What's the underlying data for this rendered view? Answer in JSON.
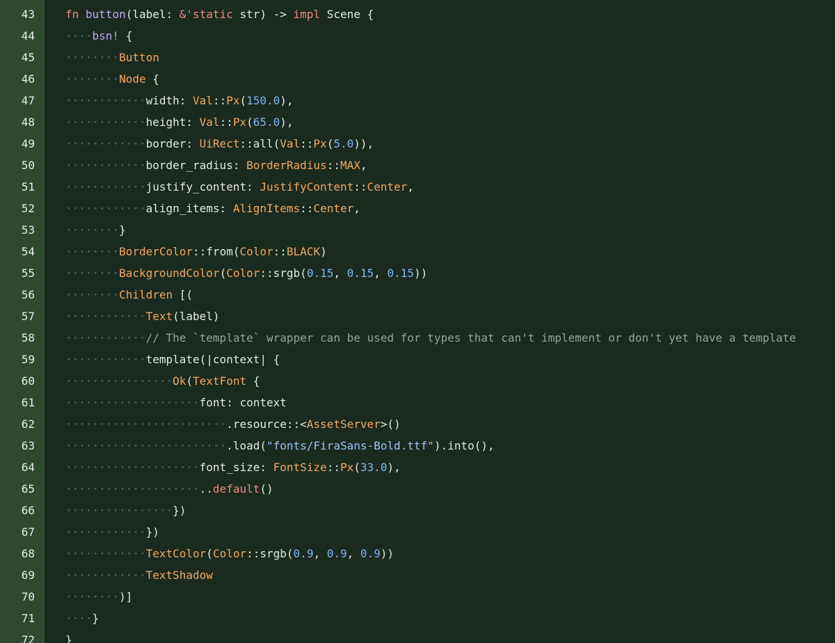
{
  "editor": {
    "colors": {
      "background": "#1a2a1e",
      "gutter": "#2d4a2f",
      "line_number": "#e8efe6",
      "indent_guide": "#5b6f5d",
      "keyword": "#ee8a86",
      "function": "#c5a6f4",
      "type": "#f3a863",
      "number": "#7db6f2",
      "string": "#9cc4f4",
      "comment": "#95a497",
      "plain": "#e4e9e1"
    },
    "lines": [
      {
        "n": "43",
        "tokens": [
          [
            "pl",
            ""
          ],
          [
            "kw",
            "fn"
          ],
          [
            "pl",
            " "
          ],
          [
            "fn",
            "button"
          ],
          [
            "pl",
            "(label: "
          ],
          [
            "kw",
            "&'static"
          ],
          [
            "pl",
            " str) "
          ],
          [
            "op",
            "->"
          ],
          [
            "pl",
            " "
          ],
          [
            "kw",
            "impl"
          ],
          [
            "pl",
            " Scene {"
          ]
        ]
      },
      {
        "n": "44",
        "tokens": [
          [
            "ind",
            "····"
          ],
          [
            "fn",
            "bsn!"
          ],
          [
            "pl",
            " {"
          ]
        ]
      },
      {
        "n": "45",
        "tokens": [
          [
            "ind",
            "········"
          ],
          [
            "ty",
            "Button"
          ]
        ]
      },
      {
        "n": "46",
        "tokens": [
          [
            "ind",
            "········"
          ],
          [
            "ty",
            "Node"
          ],
          [
            "pl",
            " {"
          ]
        ]
      },
      {
        "n": "47",
        "tokens": [
          [
            "ind",
            "············"
          ],
          [
            "pl",
            "width: "
          ],
          [
            "ty",
            "Val"
          ],
          [
            "pl",
            "::"
          ],
          [
            "ty",
            "Px"
          ],
          [
            "pl",
            "("
          ],
          [
            "num",
            "150.0"
          ],
          [
            "pl",
            "),"
          ]
        ]
      },
      {
        "n": "48",
        "tokens": [
          [
            "ind",
            "············"
          ],
          [
            "pl",
            "height: "
          ],
          [
            "ty",
            "Val"
          ],
          [
            "pl",
            "::"
          ],
          [
            "ty",
            "Px"
          ],
          [
            "pl",
            "("
          ],
          [
            "num",
            "65.0"
          ],
          [
            "pl",
            "),"
          ]
        ]
      },
      {
        "n": "49",
        "tokens": [
          [
            "ind",
            "············"
          ],
          [
            "pl",
            "border: "
          ],
          [
            "ty",
            "UiRect"
          ],
          [
            "pl",
            "::all("
          ],
          [
            "ty",
            "Val"
          ],
          [
            "pl",
            "::"
          ],
          [
            "ty",
            "Px"
          ],
          [
            "pl",
            "("
          ],
          [
            "num",
            "5.0"
          ],
          [
            "pl",
            ")),"
          ]
        ]
      },
      {
        "n": "50",
        "tokens": [
          [
            "ind",
            "············"
          ],
          [
            "pl",
            "border_radius: "
          ],
          [
            "ty",
            "BorderRadius"
          ],
          [
            "pl",
            "::"
          ],
          [
            "ty",
            "MAX"
          ],
          [
            "pl",
            ","
          ]
        ]
      },
      {
        "n": "51",
        "tokens": [
          [
            "ind",
            "············"
          ],
          [
            "pl",
            "justify_content: "
          ],
          [
            "ty",
            "JustifyContent"
          ],
          [
            "pl",
            "::"
          ],
          [
            "ty",
            "Center"
          ],
          [
            "pl",
            ","
          ]
        ]
      },
      {
        "n": "52",
        "tokens": [
          [
            "ind",
            "············"
          ],
          [
            "pl",
            "align_items: "
          ],
          [
            "ty",
            "AlignItems"
          ],
          [
            "pl",
            "::"
          ],
          [
            "ty",
            "Center"
          ],
          [
            "pl",
            ","
          ]
        ]
      },
      {
        "n": "53",
        "tokens": [
          [
            "ind",
            "········"
          ],
          [
            "pl",
            "}"
          ]
        ]
      },
      {
        "n": "54",
        "tokens": [
          [
            "ind",
            "········"
          ],
          [
            "ty",
            "BorderColor"
          ],
          [
            "pl",
            "::from("
          ],
          [
            "ty",
            "Color"
          ],
          [
            "pl",
            "::"
          ],
          [
            "ty",
            "BLACK"
          ],
          [
            "pl",
            ")"
          ]
        ]
      },
      {
        "n": "55",
        "tokens": [
          [
            "ind",
            "········"
          ],
          [
            "ty",
            "BackgroundColor"
          ],
          [
            "pl",
            "("
          ],
          [
            "ty",
            "Color"
          ],
          [
            "pl",
            "::srgb("
          ],
          [
            "num",
            "0.15"
          ],
          [
            "pl",
            ", "
          ],
          [
            "num",
            "0.15"
          ],
          [
            "pl",
            ", "
          ],
          [
            "num",
            "0.15"
          ],
          [
            "pl",
            "))"
          ]
        ]
      },
      {
        "n": "56",
        "tokens": [
          [
            "ind",
            "········"
          ],
          [
            "ty",
            "Children"
          ],
          [
            "pl",
            " [("
          ]
        ]
      },
      {
        "n": "57",
        "tokens": [
          [
            "ind",
            "············"
          ],
          [
            "ty",
            "Text"
          ],
          [
            "pl",
            "(label)"
          ]
        ]
      },
      {
        "n": "58",
        "tokens": [
          [
            "ind",
            "············"
          ],
          [
            "cm",
            "// The `template` wrapper can be used for types that can't implement or don't yet have a template"
          ]
        ]
      },
      {
        "n": "59",
        "tokens": [
          [
            "ind",
            "············"
          ],
          [
            "pl",
            "template(|context| {"
          ]
        ]
      },
      {
        "n": "60",
        "tokens": [
          [
            "ind",
            "················"
          ],
          [
            "ty",
            "Ok"
          ],
          [
            "pl",
            "("
          ],
          [
            "ty",
            "TextFont"
          ],
          [
            "pl",
            " {"
          ]
        ]
      },
      {
        "n": "61",
        "tokens": [
          [
            "ind",
            "····················"
          ],
          [
            "pl",
            "font: context"
          ]
        ]
      },
      {
        "n": "62",
        "tokens": [
          [
            "ind",
            "························"
          ],
          [
            "pl",
            ".resource::<"
          ],
          [
            "ty",
            "AssetServer"
          ],
          [
            "pl",
            ">()"
          ]
        ]
      },
      {
        "n": "63",
        "tokens": [
          [
            "ind",
            "························"
          ],
          [
            "pl",
            ".load("
          ],
          [
            "str",
            "\"fonts/FiraSans-Bold.ttf\""
          ],
          [
            "pl",
            ").into(),"
          ]
        ]
      },
      {
        "n": "64",
        "tokens": [
          [
            "ind",
            "····················"
          ],
          [
            "pl",
            "font_size: "
          ],
          [
            "ty",
            "FontSize"
          ],
          [
            "pl",
            "::"
          ],
          [
            "ty",
            "Px"
          ],
          [
            "pl",
            "("
          ],
          [
            "num",
            "33.0"
          ],
          [
            "pl",
            "),"
          ]
        ]
      },
      {
        "n": "65",
        "tokens": [
          [
            "ind",
            "····················"
          ],
          [
            "pl",
            ".."
          ],
          [
            "kw",
            "default"
          ],
          [
            "pl",
            "()"
          ]
        ]
      },
      {
        "n": "66",
        "tokens": [
          [
            "ind",
            "················"
          ],
          [
            "pl",
            "})"
          ]
        ]
      },
      {
        "n": "67",
        "tokens": [
          [
            "ind",
            "············"
          ],
          [
            "pl",
            "})"
          ]
        ]
      },
      {
        "n": "68",
        "tokens": [
          [
            "ind",
            "············"
          ],
          [
            "ty",
            "TextColor"
          ],
          [
            "pl",
            "("
          ],
          [
            "ty",
            "Color"
          ],
          [
            "pl",
            "::srgb("
          ],
          [
            "num",
            "0.9"
          ],
          [
            "pl",
            ", "
          ],
          [
            "num",
            "0.9"
          ],
          [
            "pl",
            ", "
          ],
          [
            "num",
            "0.9"
          ],
          [
            "pl",
            "))"
          ]
        ]
      },
      {
        "n": "69",
        "tokens": [
          [
            "ind",
            "············"
          ],
          [
            "ty",
            "TextShadow"
          ]
        ]
      },
      {
        "n": "70",
        "tokens": [
          [
            "ind",
            "········"
          ],
          [
            "pl",
            ")]"
          ]
        ]
      },
      {
        "n": "71",
        "tokens": [
          [
            "ind",
            "····"
          ],
          [
            "pl",
            "}"
          ]
        ]
      },
      {
        "n": "72",
        "tokens": [
          [
            "pl",
            "}"
          ]
        ]
      }
    ]
  }
}
